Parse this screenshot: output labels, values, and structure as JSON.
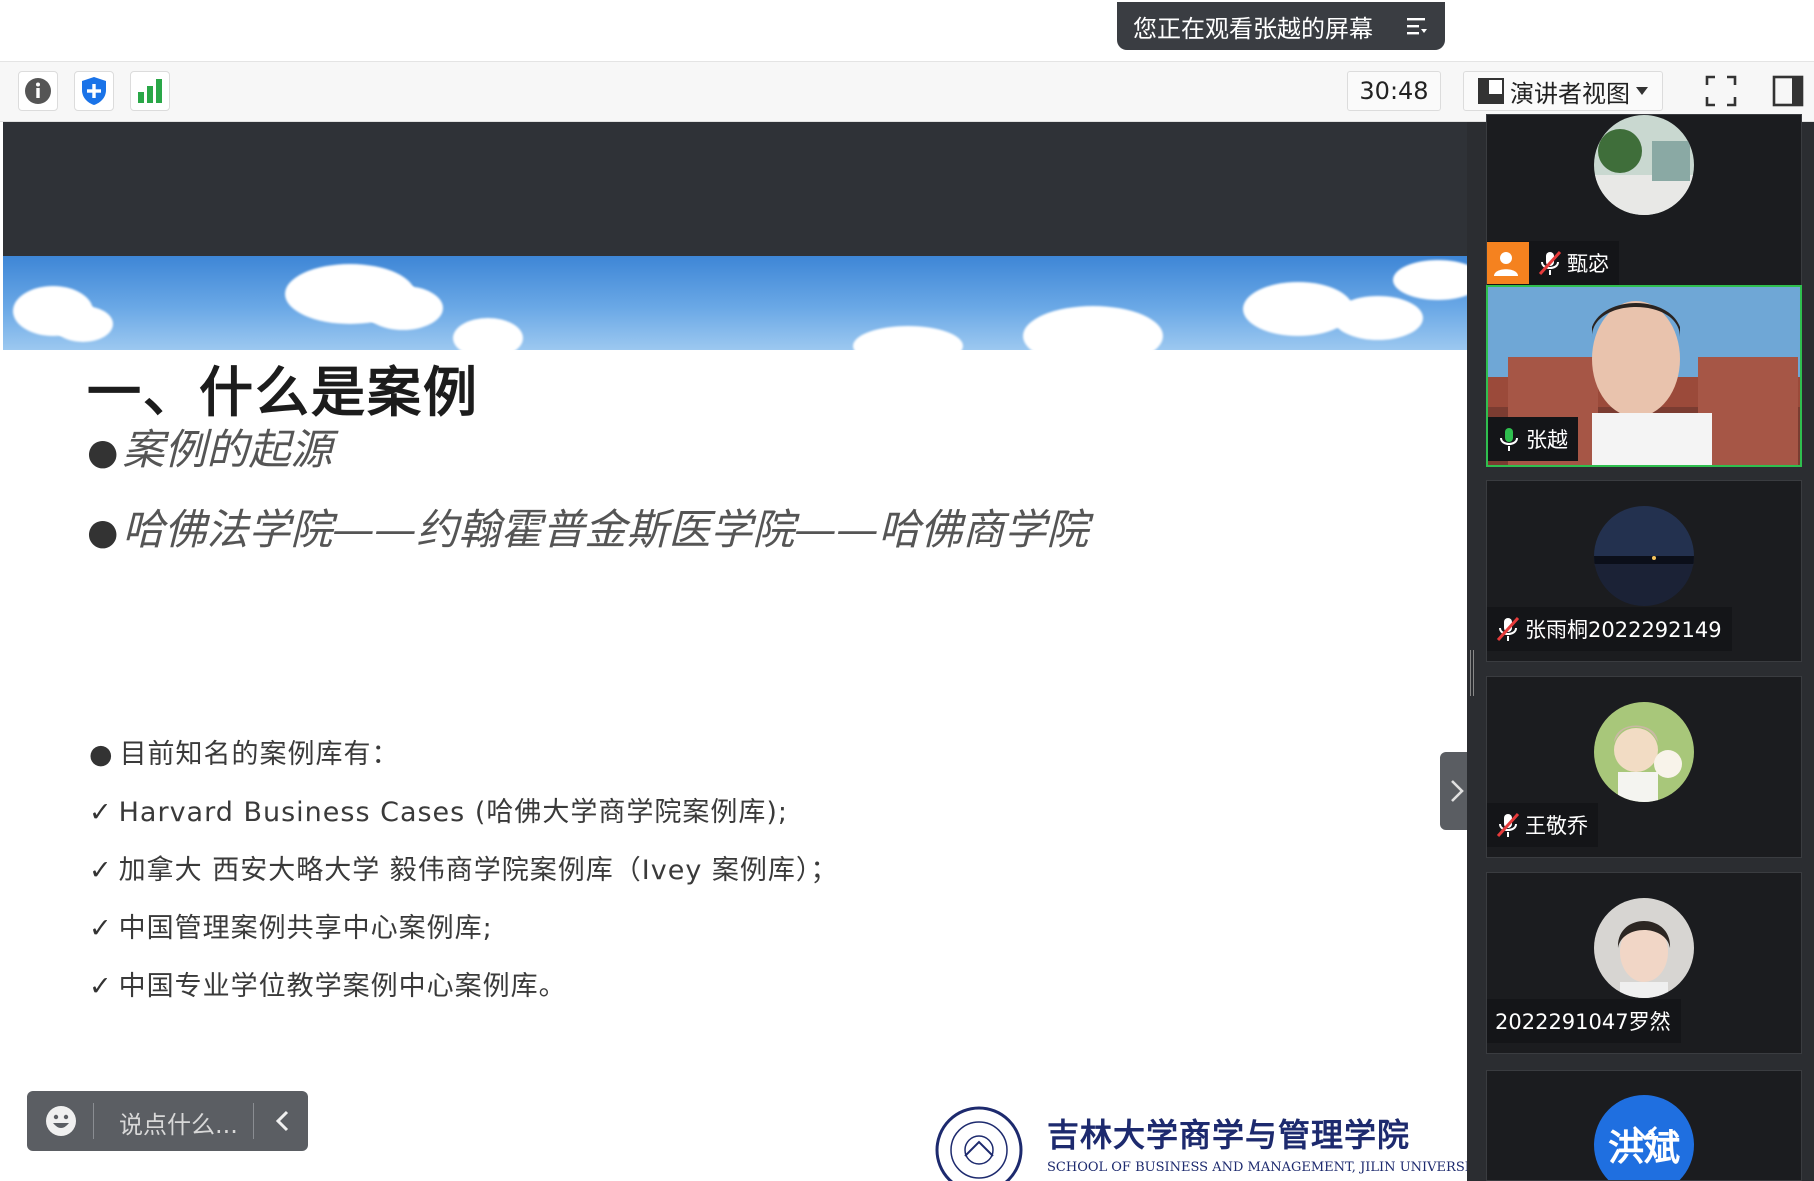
{
  "banner": {
    "text": "您正在观看张越的屏幕"
  },
  "toolbar": {
    "timer": "30:48",
    "view_mode": "演讲者视图"
  },
  "slide": {
    "title": "一、什么是案例",
    "bullets": [
      "案例的起源",
      "哈佛法学院——约翰霍普金斯医学院——哈佛商学院"
    ],
    "intro": "目前知名的案例库有：",
    "libraries": [
      "Harvard Business Cases (哈佛大学商学院案例库);",
      "加拿大 西安大略大学 毅伟商学院案例库（Ivey 案例库）；",
      "中国管理案例共享中心案例库;",
      "中国专业学位教学案例中心案例库。"
    ],
    "school_cn": "吉林大学商学与管理学院",
    "school_en": "SCHOOL OF BUSINESS AND MANAGEMENT, JILIN UNIVERSITY"
  },
  "chat": {
    "placeholder": "说点什么..."
  },
  "participants": [
    {
      "name": "甄宓",
      "muted": true,
      "host": true
    },
    {
      "name": "张越",
      "muted": false,
      "active": true
    },
    {
      "name": "张雨桐2022292149",
      "muted": true
    },
    {
      "name": "王敬乔",
      "muted": true
    },
    {
      "name": "2022291047罗然",
      "muted": false
    },
    {
      "name": "洪斌",
      "muted": false
    }
  ],
  "colors": {
    "active_border": "#2fbf4f",
    "host_badge": "#f5821f",
    "security_icon": "#1a73e8",
    "signal_icon": "#2aa748"
  },
  "icons": [
    "info-icon",
    "security-shield-icon",
    "network-signal-icon",
    "fullscreen-icon",
    "sidebar-layout-icon",
    "menu-icon",
    "mic-muted-icon",
    "mic-on-icon",
    "emoji-icon",
    "chevron-left-icon",
    "chevron-right-icon",
    "chevron-down-icon"
  ]
}
